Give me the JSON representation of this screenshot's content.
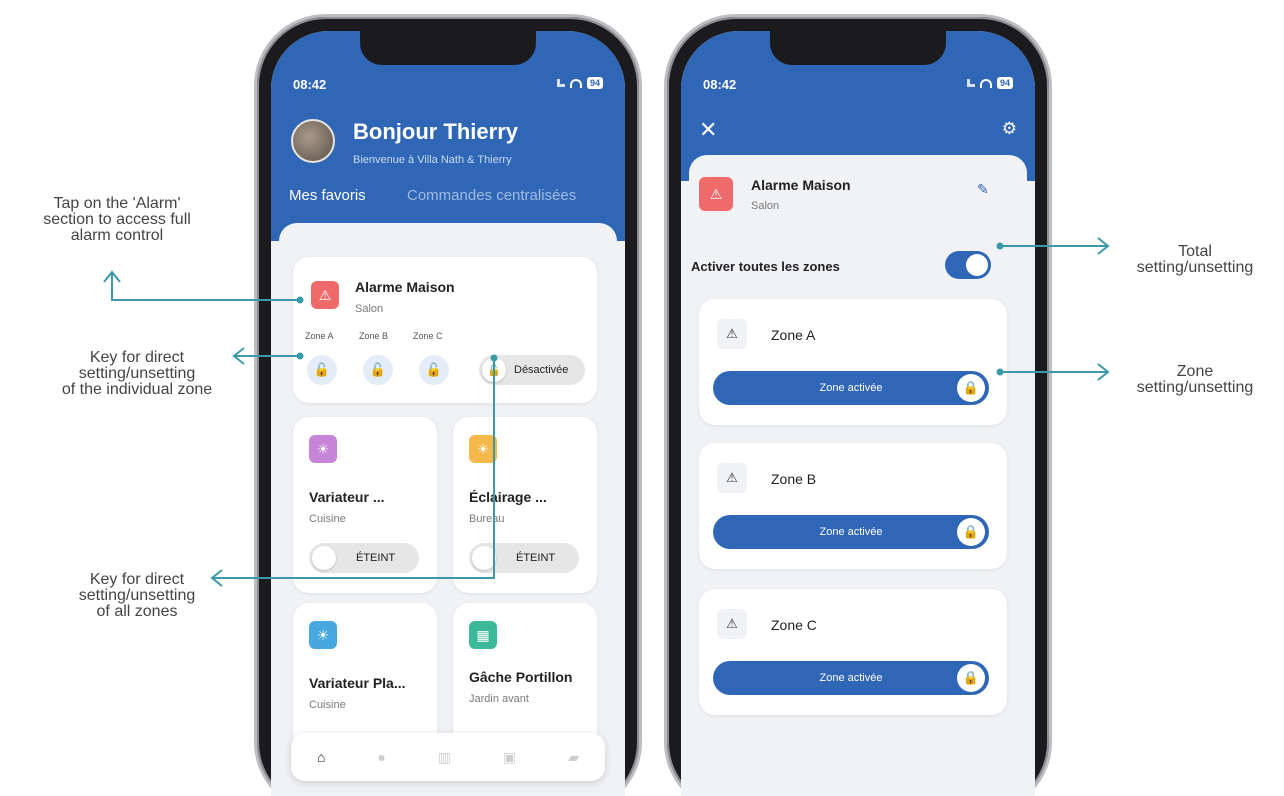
{
  "status": {
    "time": "08:42",
    "battery": "94"
  },
  "left": {
    "greeting": "Bonjour Thierry",
    "welcome": "Bienvenue à Villa Nath & Thierry",
    "tabs": [
      "Mes favoris",
      "Commandes centralisées"
    ],
    "alarm": {
      "title": "Alarme Maison",
      "room": "Salon",
      "zones": [
        "Zone A",
        "Zone B",
        "Zone C"
      ],
      "state_label": "Désactivée"
    },
    "devices": [
      {
        "title": "Variateur ...",
        "room": "Cuisine",
        "state": "ÉTEINT",
        "icon": "lightbulb-icon",
        "color": "#c685d6"
      },
      {
        "title": "Éclairage ...",
        "room": "Bureau",
        "state": "ÉTEINT",
        "icon": "lightbulb-icon",
        "color": "#f5b94b"
      },
      {
        "title": "Variateur Pla...",
        "room": "Cuisine",
        "icon": "lightbulb-icon",
        "color": "#47a8e0"
      },
      {
        "title": "Gâche Portillon",
        "room": "Jardin avant",
        "icon": "gate-icon",
        "color": "#3cb89a"
      }
    ],
    "nav": [
      "home-icon",
      "bulb-icon",
      "grid-icon",
      "device-icon",
      "folder-icon"
    ]
  },
  "right": {
    "alarm_title": "Alarme Maison",
    "alarm_room": "Salon",
    "all_zones_label": "Activer toutes les zones",
    "zones": [
      {
        "name": "Zone A",
        "state": "Zone activée"
      },
      {
        "name": "Zone B",
        "state": "Zone activée"
      },
      {
        "name": "Zone C",
        "state": "Zone activée"
      }
    ]
  },
  "annotations": {
    "tap_alarm": [
      "Tap on the 'Alarm'",
      "section to access full",
      "alarm control"
    ],
    "key_individual": [
      "Key for direct",
      "setting/unsetting",
      "of the individual zone"
    ],
    "key_all": [
      "Key for direct",
      "setting/unsetting",
      "of all zones"
    ],
    "total": [
      "Total",
      "setting/unsetting"
    ],
    "zone": [
      "Zone",
      "setting/unsetting"
    ]
  },
  "colors": {
    "primary": "#2f66b5",
    "alarm": "#ef6b6b",
    "annotation_line": "#3a9aa8"
  }
}
